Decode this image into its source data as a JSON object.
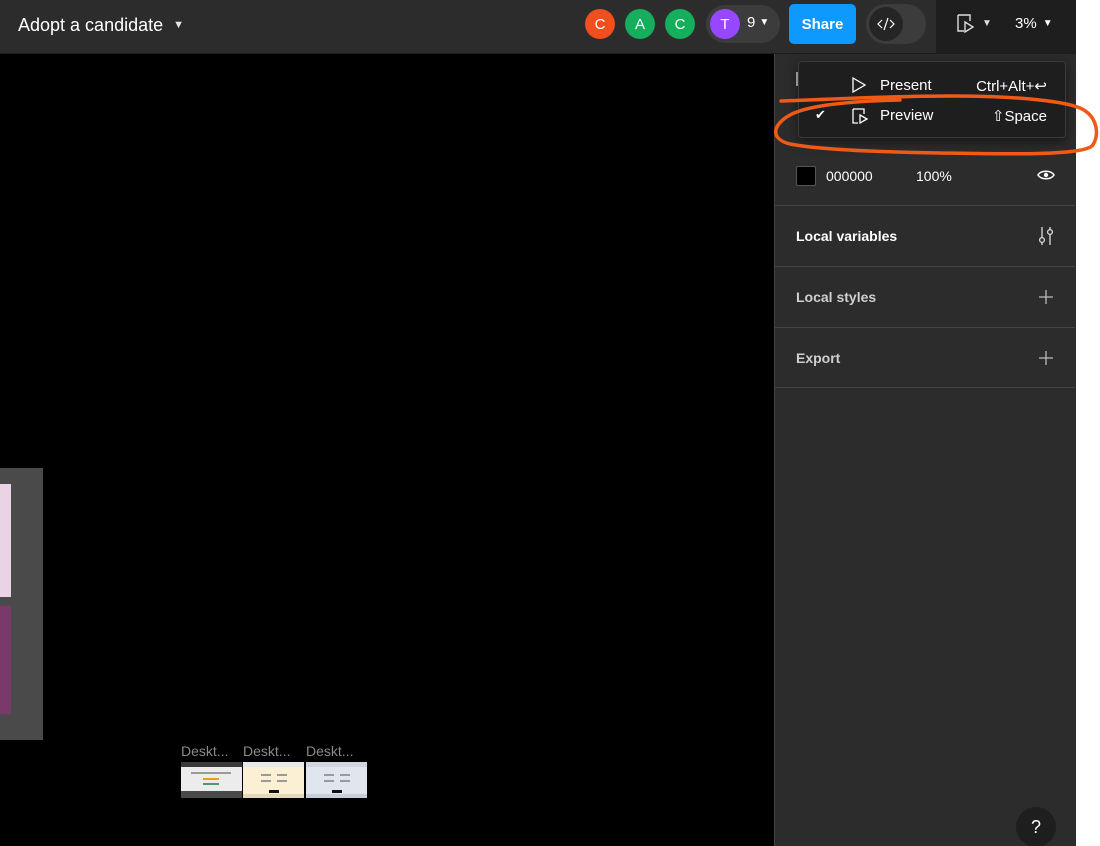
{
  "header": {
    "file_title": "Adopt a candidate",
    "chevron": "⌄",
    "avatars": [
      {
        "initial": "C",
        "color": "#f24e1e"
      },
      {
        "initial": "A",
        "color": "#14ae5c"
      },
      {
        "initial": "C",
        "color": "#14ae5c"
      },
      {
        "initial": "T",
        "color": "#9747ff"
      }
    ],
    "more_count": "9",
    "share_label": "Share",
    "zoom_label": "3%"
  },
  "menu": {
    "items": [
      {
        "label": "Present",
        "shortcut": "Ctrl+Alt+↩",
        "checked": false,
        "icon": "play-icon"
      },
      {
        "label": "Preview",
        "shortcut": "⇧Space",
        "checked": true,
        "check_mark": "✔",
        "icon": "preview-icon"
      }
    ]
  },
  "panel": {
    "background": {
      "hex": "000000",
      "opacity": "100%"
    },
    "sections": [
      {
        "title": "Local variables",
        "action_icon": "sliders-icon"
      },
      {
        "title": "Local styles",
        "action_icon": "plus-icon"
      },
      {
        "title": "Export",
        "action_icon": "plus-icon"
      }
    ],
    "help_label": "?"
  },
  "canvas": {
    "thumbnails": [
      {
        "label": "Deskt...",
        "bg": "#ececec"
      },
      {
        "label": "Deskt...",
        "bg": "#fbefd4"
      },
      {
        "label": "Deskt...",
        "bg": "#dfe6ee"
      }
    ]
  },
  "colors": {
    "accent": "#0d99ff",
    "annotation": "#f05a16",
    "canvas": "#000000",
    "panel": "#2c2c2c"
  }
}
